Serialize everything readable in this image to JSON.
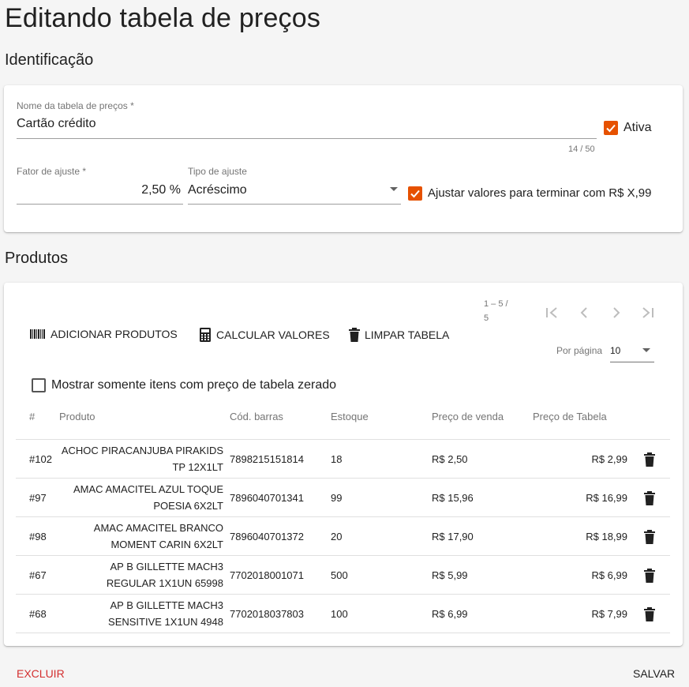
{
  "page": {
    "title": "Editando tabela de preços"
  },
  "identificacao": {
    "section_title": "Identificação",
    "nome": {
      "label": "Nome da tabela de preços *",
      "value": "Cartão crédito",
      "counter": "14 / 50"
    },
    "ativa": {
      "label": "Ativa",
      "checked": true
    },
    "fator": {
      "label": "Fator de ajuste *",
      "value": "2,50 %"
    },
    "tipo": {
      "label": "Tipo de ajuste",
      "value": "Acréscimo"
    },
    "ajustar": {
      "label": "Ajustar valores para terminar com R$ X,99",
      "checked": true
    }
  },
  "produtos": {
    "section_title": "Produtos",
    "toolbar": {
      "add_label": "ADICIONAR PRODUTOS",
      "calc_label": "CALCULAR VALORES",
      "clear_label": "LIMPAR TABELA"
    },
    "pager": {
      "range_line1": "1 – 5 /",
      "range_line2": "5",
      "per_page_label": "Por página",
      "per_page_value": "10"
    },
    "filter": {
      "label": "Mostrar somente itens com preço de tabela zerado",
      "checked": false
    },
    "columns": {
      "id": "#",
      "produto": "Produto",
      "barras": "Cód. barras",
      "estoque": "Estoque",
      "venda": "Preço de venda",
      "tabela": "Preço de Tabela"
    },
    "rows": [
      {
        "id": "#102",
        "name1": "ACHOC PIRACANJUBA PIRAKIDS",
        "name2": "TP 12X1LT",
        "barcode": "7898215151814",
        "stock": "18",
        "sale": "R$ 2,50",
        "table": "R$ 2,99"
      },
      {
        "id": "#97",
        "name1": "AMAC AMACITEL AZUL TOQUE",
        "name2": "POESIA 6X2LT",
        "barcode": "7896040701341",
        "stock": "99",
        "sale": "R$ 15,96",
        "table": "R$ 16,99"
      },
      {
        "id": "#98",
        "name1": "AMAC AMACITEL BRANCO",
        "name2": "MOMENT CARIN 6X2LT",
        "barcode": "7896040701372",
        "stock": "20",
        "sale": "R$ 17,90",
        "table": "R$ 18,99"
      },
      {
        "id": "#67",
        "name1": "AP B GILLETTE MACH3",
        "name2": "REGULAR 1X1UN 65998",
        "barcode": "7702018001071",
        "stock": "500",
        "sale": "R$ 5,99",
        "table": "R$ 6,99"
      },
      {
        "id": "#68",
        "name1": "AP B GILLETTE MACH3",
        "name2": "SENSITIVE 1X1UN 4948",
        "barcode": "7702018037803",
        "stock": "100",
        "sale": "R$ 6,99",
        "table": "R$ 7,99"
      }
    ]
  },
  "footer": {
    "delete_label": "EXCLUIR",
    "save_label": "SALVAR"
  },
  "colors": {
    "accent": "#e65100",
    "danger": "#d32f2f"
  },
  "icons": [
    "barcode-icon",
    "calculator-icon",
    "trash-icon",
    "first-page-icon",
    "prev-page-icon",
    "next-page-icon",
    "last-page-icon",
    "dropdown-arrow-icon",
    "check-icon"
  ]
}
